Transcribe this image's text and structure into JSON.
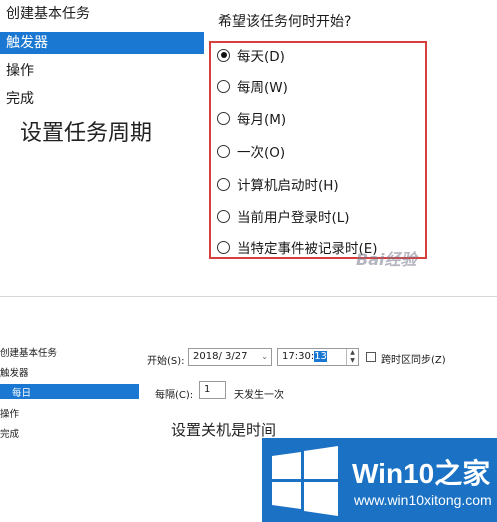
{
  "top": {
    "nav_items": [
      "创建基本任务",
      "触发器",
      "操作",
      "完成"
    ],
    "selected_nav": 1,
    "question": "希望该任务何时开始?",
    "caption": "设置任务周期",
    "options": [
      {
        "label": "每天(D)",
        "checked": true
      },
      {
        "label": "每周(W)",
        "checked": false
      },
      {
        "label": "每月(M)",
        "checked": false
      },
      {
        "label": "一次(O)",
        "checked": false
      },
      {
        "label": "计算机启动时(H)",
        "checked": false
      },
      {
        "label": "当前用户登录时(L)",
        "checked": false
      },
      {
        "label": "当特定事件被记录时(E)",
        "checked": false
      }
    ],
    "highlight_color": "#d84040"
  },
  "bottom": {
    "nav_items": [
      "创建基本任务",
      "触发器",
      "每日",
      "操作",
      "完成"
    ],
    "selected_nav": 2,
    "start_label": "开始(S):",
    "date_value": "2018/ 3/27",
    "time_prefix": "17:30:",
    "time_selected": "13",
    "sync_label": "跨时区同步(Z)",
    "sync_checked": false,
    "interval_label": "每隔(C):",
    "interval_value": "1",
    "interval_suffix": "天发生一次",
    "caption": "设置关机是时间"
  },
  "watermarks": {
    "baidu": "Bai经验",
    "win10_brand_a": "Win10",
    "win10_brand_b": "之家",
    "win10_url": "www.win10xitong.com",
    "banner_color": "#1b72c4"
  },
  "icons": [
    "radio-button-icon",
    "dropdown-arrow-icon",
    "spinner-icon",
    "checkbox-icon",
    "windows-logo-icon"
  ],
  "accent": "#1a78d2"
}
